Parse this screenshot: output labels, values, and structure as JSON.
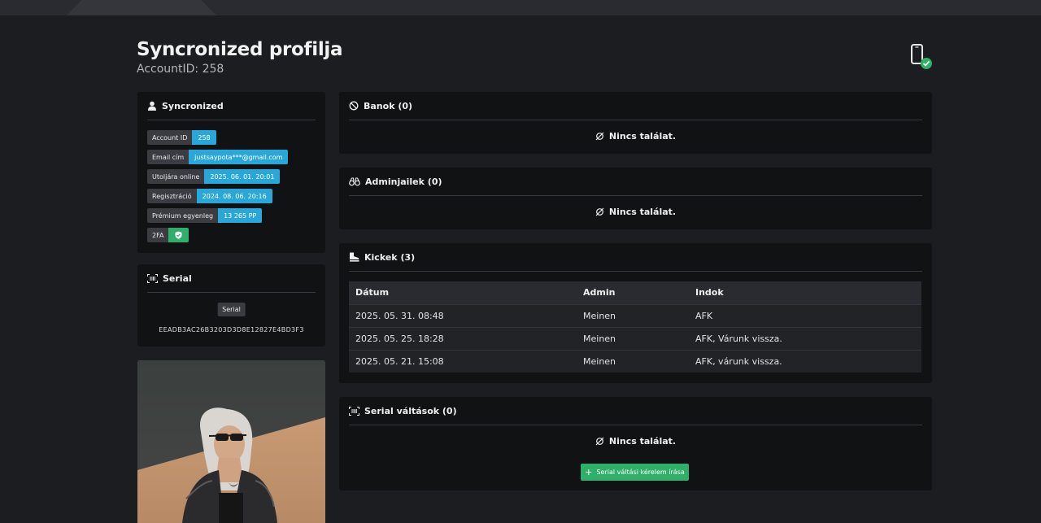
{
  "profile": {
    "title": "Syncronized profilja",
    "account_line": "AccountID: 258"
  },
  "account_card": {
    "heading": "Syncronized",
    "rows": [
      {
        "label": "Account ID",
        "value": "258"
      },
      {
        "label": "Email cím",
        "value": "justsaypota***@gmail.com"
      },
      {
        "label": "Utoljára online",
        "value": "2025. 06. 01. 20:01"
      },
      {
        "label": "Regisztráció",
        "value": "2024. 08. 06. 20:16"
      },
      {
        "label": "Prémium egyenleg",
        "value": "13 265 PP"
      }
    ],
    "twofa_label": "2FA",
    "twofa_icon": "shield-check-icon"
  },
  "serial_card": {
    "heading": "Serial",
    "badge": "Serial",
    "value": "EEADB3AC26B3203D3D8E12827E4BD3F3"
  },
  "bans": {
    "heading": "Banok (0)",
    "empty": "Nincs találat."
  },
  "admin_jails": {
    "heading": "Adminjailek (0)",
    "empty": "Nincs találat."
  },
  "kicks": {
    "heading": "Kickek (3)",
    "columns": [
      "Dátum",
      "Admin",
      "Indok"
    ],
    "rows": [
      [
        "2025. 05. 31. 08:48",
        "Meinen",
        "AFK"
      ],
      [
        "2025. 05. 25. 18:28",
        "Meinen",
        "AFK, Várunk vissza."
      ],
      [
        "2025. 05. 21. 15:08",
        "Meinen",
        "AFK, várunk vissza."
      ]
    ]
  },
  "serial_changes": {
    "heading": "Serial váltások (0)",
    "empty": "Nincs találat.",
    "button": "Serial váltási kérelem írása"
  },
  "colors": {
    "accent_blue": "#29a7d9",
    "accent_green": "#2fb06a",
    "background": "#1c1d21",
    "card": "#111214"
  }
}
